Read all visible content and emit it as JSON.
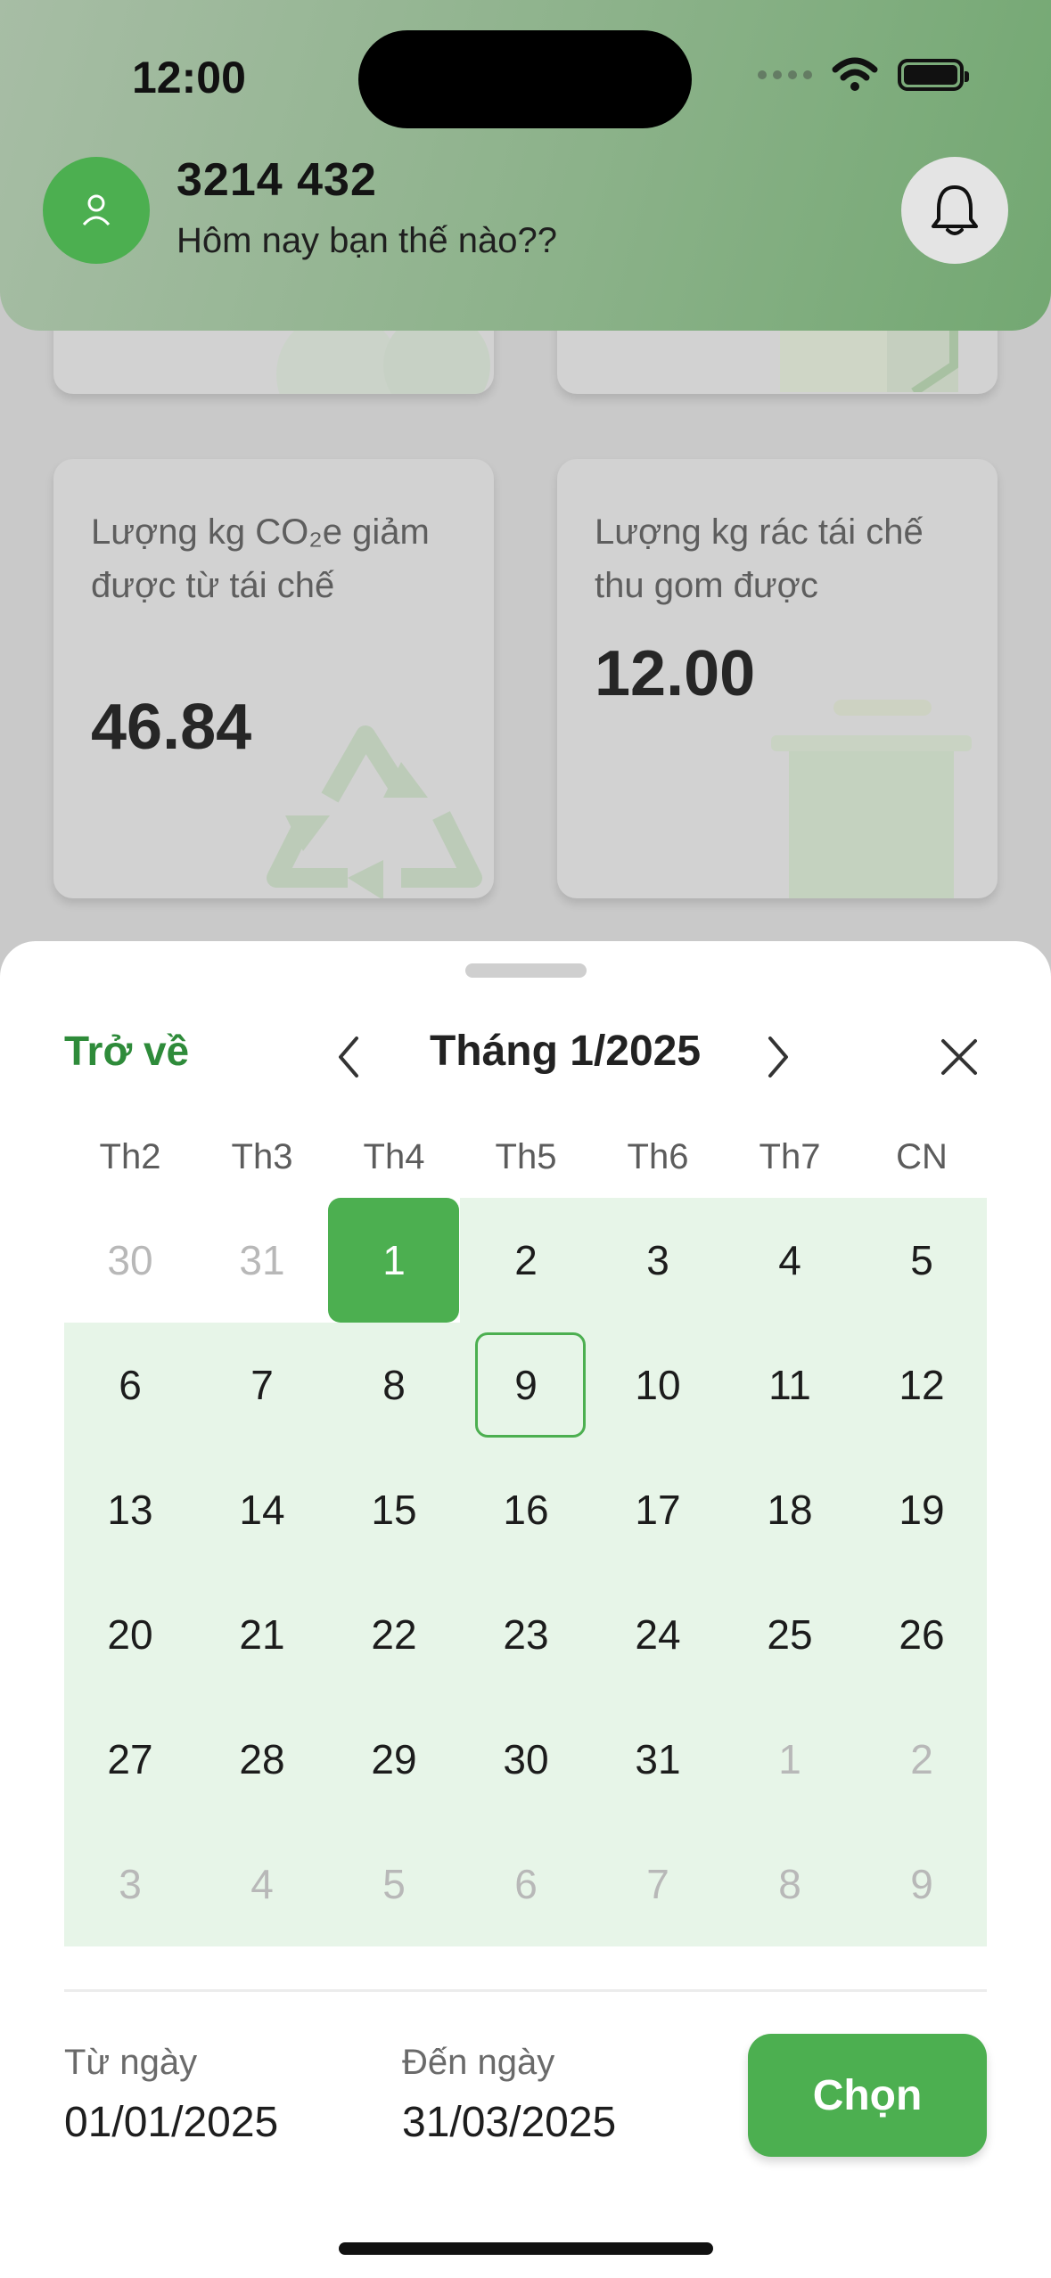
{
  "status_bar": {
    "time": "12:00"
  },
  "header": {
    "user_name": "3214 432",
    "greeting": "Hôm nay bạn thế nào??"
  },
  "stats": [
    {
      "label": "Lượng kg CO₂e giảm được từ tái chế",
      "value": "46.84"
    },
    {
      "label": "Lượng kg rác tái chế thu gom được",
      "value": "12.00"
    }
  ],
  "calendar": {
    "back_label": "Trở về",
    "month_title": "Tháng 1/2025",
    "weekdays": [
      "Th2",
      "Th3",
      "Th4",
      "Th5",
      "Th6",
      "Th7",
      "CN"
    ],
    "weeks": [
      [
        "30",
        "31",
        "1",
        "2",
        "3",
        "4",
        "5"
      ],
      [
        "6",
        "7",
        "8",
        "9",
        "10",
        "11",
        "12"
      ],
      [
        "13",
        "14",
        "15",
        "16",
        "17",
        "18",
        "19"
      ],
      [
        "20",
        "21",
        "22",
        "23",
        "24",
        "25",
        "26"
      ],
      [
        "27",
        "28",
        "29",
        "30",
        "31",
        "1",
        "2"
      ],
      [
        "3",
        "4",
        "5",
        "6",
        "7",
        "8",
        "9"
      ]
    ],
    "selected_start": "1",
    "today": "9"
  },
  "range": {
    "from_label": "Từ ngày",
    "from_value": "01/01/2025",
    "to_label": "Đến ngày",
    "to_value": "31/03/2025",
    "choose_label": "Chọn"
  },
  "colors": {
    "accent": "#4caf50",
    "accent_dark": "#2e8b3a",
    "range_fill": "#e7f5e8"
  }
}
